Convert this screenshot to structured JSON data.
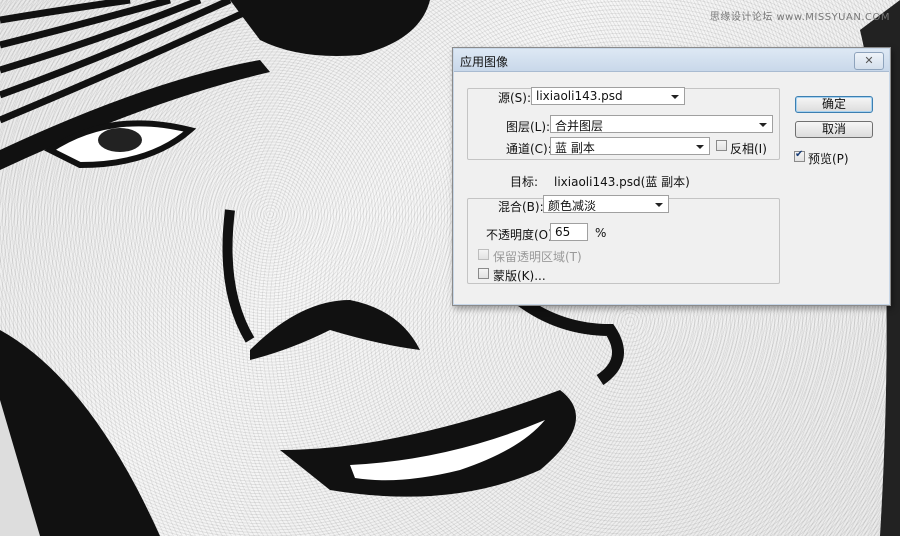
{
  "watermark": "思缘设计论坛 www.MISSYUAN.COM",
  "dialog": {
    "title": "应用图像",
    "close_icon": "close-icon",
    "source": {
      "source_label": "源(S):",
      "source_value": "lixiaoli143.psd",
      "layer_label": "图层(L):",
      "layer_value": "合并图层",
      "channel_label": "通道(C):",
      "channel_value": "蓝 副本",
      "invert_label": "反相(I)",
      "invert_checked": false
    },
    "target_label": "目标:",
    "target_value": "lixiaoli143.psd(蓝 副本)",
    "blending": {
      "blend_label": "混合(B):",
      "blend_value": "颜色减淡",
      "opacity_label": "不透明度(O):",
      "opacity_value": "65",
      "opacity_unit": "%",
      "preserve_label": "保留透明区域(T)",
      "preserve_checked": false,
      "preserve_disabled": true,
      "mask_label": "蒙版(K)...",
      "mask_checked": false
    },
    "buttons": {
      "ok": "确定",
      "cancel": "取消"
    },
    "preview_label": "预览(P)",
    "preview_checked": true
  }
}
